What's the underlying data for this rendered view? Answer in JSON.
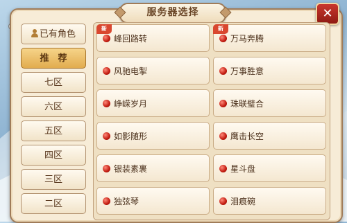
{
  "title": "服务器选择",
  "close_label": "✕",
  "sidebar": {
    "tabs": [
      {
        "label": "已有角色"
      },
      {
        "label": "推　荐"
      },
      {
        "label": "七区"
      },
      {
        "label": "六区"
      },
      {
        "label": "五区"
      },
      {
        "label": "四区"
      },
      {
        "label": "三区"
      },
      {
        "label": "二区"
      }
    ]
  },
  "servers": [
    {
      "name": "峰回路转",
      "badge": "新"
    },
    {
      "name": "万马奔腾",
      "badge": "新"
    },
    {
      "name": "风驰电掣"
    },
    {
      "name": "万事胜意"
    },
    {
      "name": "峥嵘岁月"
    },
    {
      "name": "珠联璧合"
    },
    {
      "name": "如影随形"
    },
    {
      "name": "鹰击长空"
    },
    {
      "name": "银装素裹"
    },
    {
      "name": "星斗盘"
    },
    {
      "name": "独弦琴"
    },
    {
      "name": "泪痕碗"
    }
  ],
  "colors": {
    "accent": "#e2ac4e",
    "status_dot": "#c21b10",
    "close": "#b02a22"
  }
}
